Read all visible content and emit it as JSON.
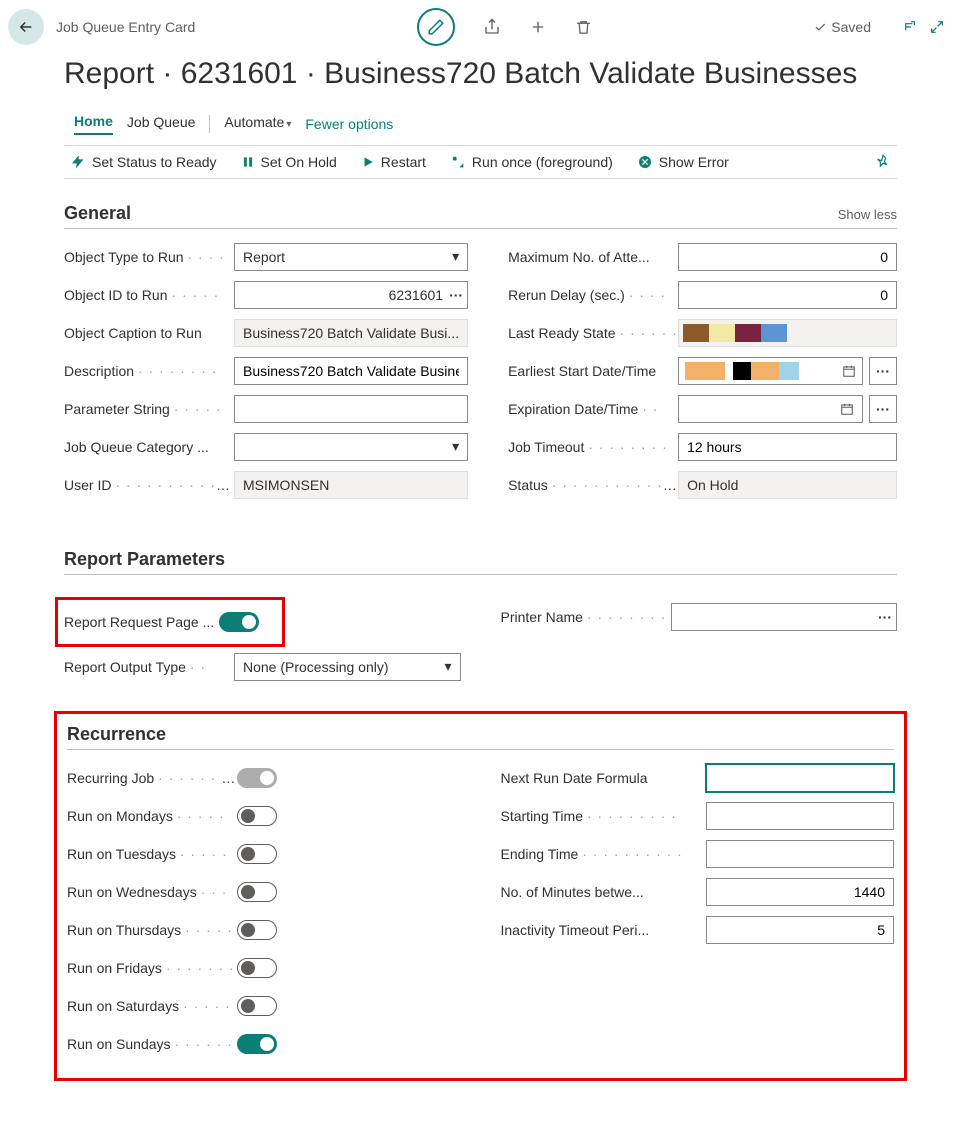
{
  "breadcrumb": "Job Queue Entry Card",
  "saved_label": "Saved",
  "page_title": "Report · 6231601 · Business720 Batch Validate Businesses",
  "tabs": {
    "home": "Home",
    "job_queue": "Job Queue",
    "automate": "Automate",
    "fewer": "Fewer options"
  },
  "actions": {
    "set_ready": "Set Status to Ready",
    "set_hold": "Set On Hold",
    "restart": "Restart",
    "run_once": "Run once (foreground)",
    "show_error": "Show Error"
  },
  "sections": {
    "general": {
      "title": "General",
      "showless": "Show less",
      "fields": {
        "object_type": {
          "label": "Object Type to Run",
          "value": "Report"
        },
        "object_id": {
          "label": "Object ID to Run",
          "value": "6231601"
        },
        "object_caption": {
          "label": "Object Caption to Run",
          "value": "Business720 Batch Validate Busi..."
        },
        "description": {
          "label": "Description",
          "value": "Business720 Batch Validate Busine"
        },
        "parameter_string": {
          "label": "Parameter String",
          "value": ""
        },
        "job_queue_cat": {
          "label": "Job Queue Category ...",
          "value": ""
        },
        "user_id": {
          "label": "User ID",
          "value": "MSIMONSEN"
        },
        "max_attempts": {
          "label": "Maximum No. of Atte...",
          "value": "0"
        },
        "rerun_delay": {
          "label": "Rerun Delay (sec.)",
          "value": "0"
        },
        "last_ready": {
          "label": "Last Ready State",
          "colors": [
            "#8a5a2b",
            "#f3e9a6",
            "#7b2242",
            "#5b95d6"
          ]
        },
        "earliest_start": {
          "label": "Earliest Start Date/Time",
          "colors": [
            "#f2b068",
            "#000000",
            "#f2b068",
            "#9fd3e8"
          ]
        },
        "expiration": {
          "label": "Expiration Date/Time"
        },
        "job_timeout": {
          "label": "Job Timeout",
          "value": "12 hours"
        },
        "status": {
          "label": "Status",
          "value": "On Hold"
        }
      }
    },
    "report_params": {
      "title": "Report Parameters",
      "fields": {
        "request_page": {
          "label": "Report Request Page ...",
          "on": true
        },
        "output_type": {
          "label": "Report Output Type",
          "value": "None (Processing only)"
        },
        "printer": {
          "label": "Printer Name"
        }
      }
    },
    "recurrence": {
      "title": "Recurrence",
      "fields": {
        "recurring": {
          "label": "Recurring Job",
          "state": "ongrey"
        },
        "mon": {
          "label": "Run on Mondays",
          "state": "off"
        },
        "tue": {
          "label": "Run on Tuesdays",
          "state": "off"
        },
        "wed": {
          "label": "Run on Wednesdays",
          "state": "off"
        },
        "thu": {
          "label": "Run on Thursdays",
          "state": "off"
        },
        "fri": {
          "label": "Run on Fridays",
          "state": "off"
        },
        "sat": {
          "label": "Run on Saturdays",
          "state": "off"
        },
        "sun": {
          "label": "Run on Sundays",
          "state": "on"
        },
        "next_run": {
          "label": "Next Run Date Formula",
          "value": ""
        },
        "starting": {
          "label": "Starting Time",
          "value": ""
        },
        "ending": {
          "label": "Ending Time",
          "value": ""
        },
        "minutes_between": {
          "label": "No. of Minutes betwe...",
          "value": "1440"
        },
        "inactivity": {
          "label": "Inactivity Timeout Peri...",
          "value": "5"
        }
      }
    }
  }
}
